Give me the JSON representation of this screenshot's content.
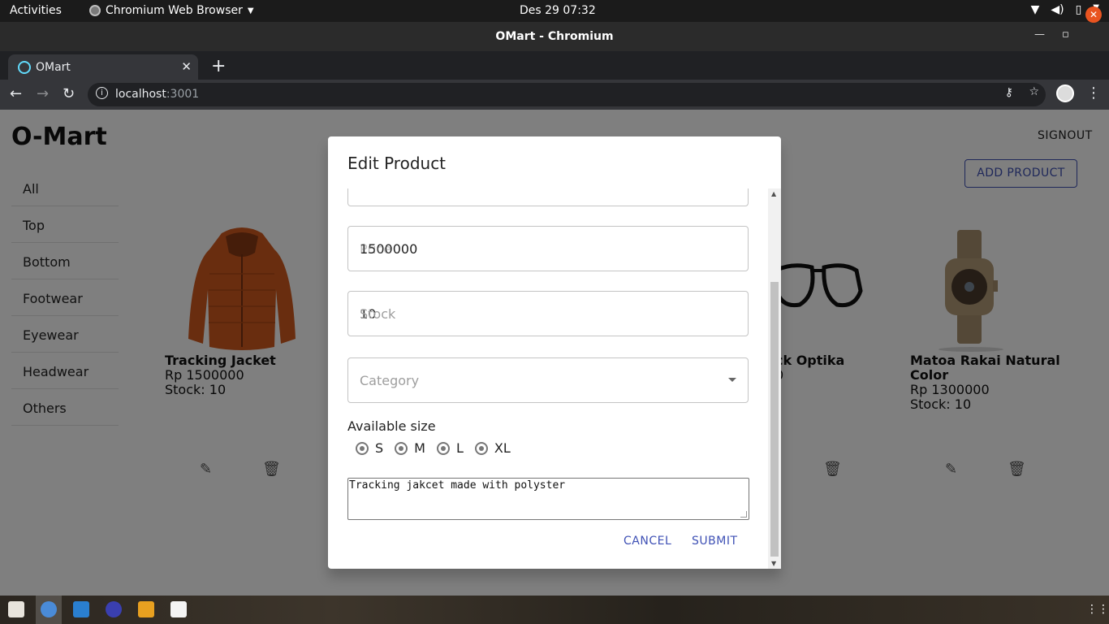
{
  "system_bar": {
    "activities": "Activities",
    "app_name": "Chromium Web Browser",
    "clock": "Des 29  07:32"
  },
  "window": {
    "title": "OMart - Chromium"
  },
  "browser": {
    "tab_title": "OMart",
    "url_host": "localhost",
    "url_port": ":3001"
  },
  "app": {
    "brand": "O-Mart",
    "signout": "SIGNOUT",
    "add_product": "ADD PRODUCT",
    "categories": [
      "All",
      "Top",
      "Bottom",
      "Footwear",
      "Eyewear",
      "Headwear",
      "Others"
    ],
    "products": [
      {
        "name": "Tracking Jacket",
        "price": "Rp 1500000",
        "stock": "Stock: 10"
      },
      {
        "name": "ck Optika",
        "price": "",
        "stock": "0"
      },
      {
        "name": "Matoa Rakai Natural Color",
        "price": "Rp 1300000",
        "stock": "Stock: 10"
      }
    ]
  },
  "dialog": {
    "title": "Edit Product",
    "price_value": "1500000",
    "price_label": "Price",
    "stock_value": "10",
    "stock_label": "Stock",
    "category_placeholder": "Category",
    "sizes_label": "Available size",
    "sizes": [
      "S",
      "M",
      "L",
      "XL"
    ],
    "description": "Tracking jakcet made with polyster",
    "cancel": "CANCEL",
    "submit": "SUBMIT"
  },
  "colors": {
    "accent": "#3f51b5",
    "overlay": "rgba(0,0,0,0.5)",
    "ubuntu_orange": "#e95420"
  }
}
